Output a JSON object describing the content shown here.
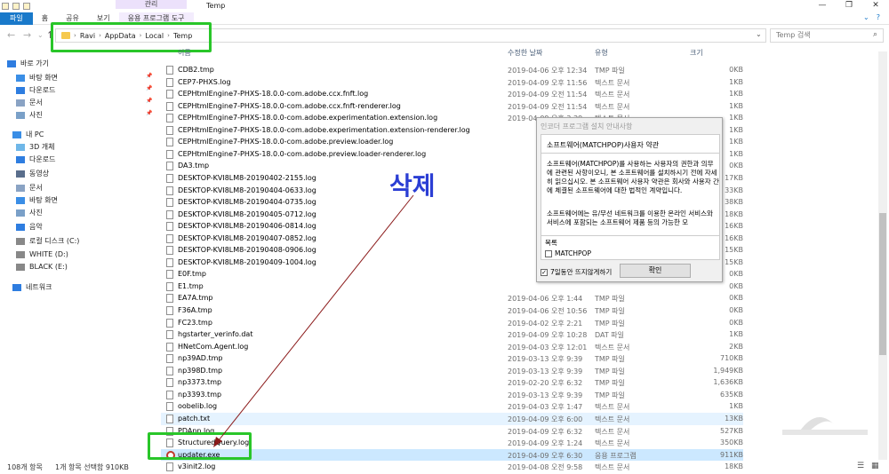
{
  "titlebar": {
    "context_tab": "관리",
    "title": "Temp"
  },
  "ribbon": {
    "tabs": [
      "파일",
      "홈",
      "공유",
      "보기",
      "응용 프로그램 도구"
    ]
  },
  "address": {
    "crumbs": [
      "Ravi",
      "AppData",
      "Local",
      "Temp"
    ],
    "search_placeholder": "Temp 검색"
  },
  "sidebar": {
    "items": [
      {
        "label": "바로 가기",
        "icon": "star-icon",
        "pin": false
      },
      {
        "label": "바탕 화면",
        "icon": "desktop-icon",
        "pin": true
      },
      {
        "label": "다운로드",
        "icon": "download-icon",
        "pin": true
      },
      {
        "label": "문서",
        "icon": "document-icon",
        "pin": true
      },
      {
        "label": "사진",
        "icon": "pictures-icon",
        "pin": true
      },
      {
        "label": "내 PC",
        "icon": "pc-icon",
        "pin": false
      },
      {
        "label": "3D 개체",
        "icon": "3d-icon",
        "pin": false
      },
      {
        "label": "다운로드",
        "icon": "download-icon",
        "pin": false
      },
      {
        "label": "동영상",
        "icon": "video-icon",
        "pin": false
      },
      {
        "label": "문서",
        "icon": "document-icon",
        "pin": false
      },
      {
        "label": "바탕 화면",
        "icon": "desktop-icon",
        "pin": false
      },
      {
        "label": "사진",
        "icon": "pictures-icon",
        "pin": false
      },
      {
        "label": "음악",
        "icon": "music-icon",
        "pin": false
      },
      {
        "label": "로컬 디스크 (C:)",
        "icon": "drive-icon",
        "pin": false
      },
      {
        "label": "WHITE (D:)",
        "icon": "drive-icon",
        "pin": false
      },
      {
        "label": "BLACK (E:)",
        "icon": "drive-icon",
        "pin": false
      },
      {
        "label": "네트워크",
        "icon": "network-icon",
        "pin": false
      }
    ]
  },
  "columns": {
    "name": "이름",
    "date": "수정한 날짜",
    "type": "유형",
    "size": "크기"
  },
  "files": [
    {
      "name": "CDB2.tmp",
      "date": "2019-04-06 오후 12:34",
      "type": "TMP 파일",
      "size": "0KB"
    },
    {
      "name": "CEP7-PHXS.log",
      "date": "2019-04-09 오후 11:56",
      "type": "텍스트 문서",
      "size": "1KB"
    },
    {
      "name": "CEPHtmlEngine7-PHXS-18.0.0-com.adobe.ccx.fnft.log",
      "date": "2019-04-09 오전 11:54",
      "type": "텍스트 문서",
      "size": "1KB"
    },
    {
      "name": "CEPHtmlEngine7-PHXS-18.0.0-com.adobe.ccx.fnft-renderer.log",
      "date": "2019-04-09 오전 11:54",
      "type": "텍스트 문서",
      "size": "1KB"
    },
    {
      "name": "CEPHtmlEngine7-PHXS-18.0.0-com.adobe.experimentation.extension.log",
      "date": "2019-04-09 오후 3:29",
      "type": "텍스트 문서",
      "size": "1KB"
    },
    {
      "name": "CEPHtmlEngine7-PHXS-18.0.0-com.adobe.experimentation.extension-renderer.log",
      "date": "",
      "type": "",
      "size": "1KB"
    },
    {
      "name": "CEPHtmlEngine7-PHXS-18.0.0-com.adobe.preview.loader.log",
      "date": "",
      "type": "",
      "size": "1KB"
    },
    {
      "name": "CEPHtmlEngine7-PHXS-18.0.0-com.adobe.preview.loader-renderer.log",
      "date": "",
      "type": "",
      "size": "1KB"
    },
    {
      "name": "DA3.tmp",
      "date": "",
      "type": "",
      "size": "0KB"
    },
    {
      "name": "DESKTOP-KVI8LM8-20190402-2155.log",
      "date": "",
      "type": "",
      "size": "17KB"
    },
    {
      "name": "DESKTOP-KVI8LM8-20190404-0633.log",
      "date": "",
      "type": "",
      "size": "33KB"
    },
    {
      "name": "DESKTOP-KVI8LM8-20190404-0735.log",
      "date": "",
      "type": "",
      "size": "38KB"
    },
    {
      "name": "DESKTOP-KVI8LM8-20190405-0712.log",
      "date": "",
      "type": "",
      "size": "18KB"
    },
    {
      "name": "DESKTOP-KVI8LM8-20190406-0814.log",
      "date": "",
      "type": "",
      "size": "16KB"
    },
    {
      "name": "DESKTOP-KVI8LM8-20190407-0852.log",
      "date": "",
      "type": "",
      "size": "16KB"
    },
    {
      "name": "DESKTOP-KVI8LM8-20190408-0906.log",
      "date": "",
      "type": "",
      "size": "15KB"
    },
    {
      "name": "DESKTOP-KVI8LM8-20190409-1004.log",
      "date": "",
      "type": "",
      "size": "15KB"
    },
    {
      "name": "E0F.tmp",
      "date": "",
      "type": "",
      "size": "0KB"
    },
    {
      "name": "E1.tmp",
      "date": "",
      "type": "",
      "size": "0KB"
    },
    {
      "name": "EA7A.tmp",
      "date": "2019-04-06 오후 1:44",
      "type": "TMP 파일",
      "size": "0KB"
    },
    {
      "name": "F36A.tmp",
      "date": "2019-04-06 오전 10:56",
      "type": "TMP 파일",
      "size": "0KB"
    },
    {
      "name": "FC23.tmp",
      "date": "2019-04-02 오후 2:21",
      "type": "TMP 파일",
      "size": "0KB"
    },
    {
      "name": "hgstarter_verinfo.dat",
      "date": "2019-04-09 오후 10:28",
      "type": "DAT 파일",
      "size": "1KB"
    },
    {
      "name": "HNetCom.Agent.log",
      "date": "2019-04-03 오후 12:01",
      "type": "텍스트 문서",
      "size": "2KB"
    },
    {
      "name": "np39AD.tmp",
      "date": "2019-03-13 오후 9:39",
      "type": "TMP 파일",
      "size": "710KB"
    },
    {
      "name": "np398D.tmp",
      "date": "2019-03-13 오후 9:39",
      "type": "TMP 파일",
      "size": "1,949KB"
    },
    {
      "name": "np3373.tmp",
      "date": "2019-02-20 오후 6:32",
      "type": "TMP 파일",
      "size": "1,636KB"
    },
    {
      "name": "np3393.tmp",
      "date": "2019-03-13 오후 9:39",
      "type": "TMP 파일",
      "size": "635KB"
    },
    {
      "name": "oobelib.log",
      "date": "2019-04-03 오후 1:47",
      "type": "텍스트 문서",
      "size": "1KB"
    },
    {
      "name": "patch.txt",
      "date": "2019-04-09 오후 6:00",
      "type": "텍스트 문서",
      "size": "13KB"
    },
    {
      "name": "PDApp.log",
      "date": "2019-04-09 오후 6:32",
      "type": "텍스트 문서",
      "size": "527KB"
    },
    {
      "name": "StructuredQuery.log",
      "date": "2019-04-09 오후 1:24",
      "type": "텍스트 문서",
      "size": "350KB"
    },
    {
      "name": "updater.exe",
      "date": "2019-04-09 오후 6:30",
      "type": "응용 프로그램",
      "size": "911KB"
    },
    {
      "name": "v3init2.log",
      "date": "2019-04-08 오전 9:58",
      "type": "텍스트 문서",
      "size": "18KB"
    }
  ],
  "status": {
    "count": "108개 항목",
    "selected": "1개 항목 선택함 910KB"
  },
  "dialog": {
    "title": "인코더 프로그램 설치 안내사항",
    "heading": "소프트웨어(MATCHPOP)사용자 약관",
    "para1": "소프트웨어(MATCHPOP)를 사용하는 사용자의 권한과 의무에 관련된 사항이오니, 본 소프트웨어를 설치하시기 전에 자세히 읽으십시오. 본 소프트웨어 사용자 약관은 회사와 사용자 간에 체결된 소프트웨어에 대한 법적인 계약입니다.",
    "para2": "소프트웨어에는 유/무선 네트워크를 이용한 온라인 서비스와 서비스에 포함되는 소프트웨어 제품 등의 가능한 모",
    "list_header": "목록",
    "list_item": "MATCHPOP",
    "dont_show": "7일동안 뜨지않게하기",
    "ok": "확인"
  },
  "annotation": {
    "text": "삭제",
    "color": "#2b3ed4"
  }
}
